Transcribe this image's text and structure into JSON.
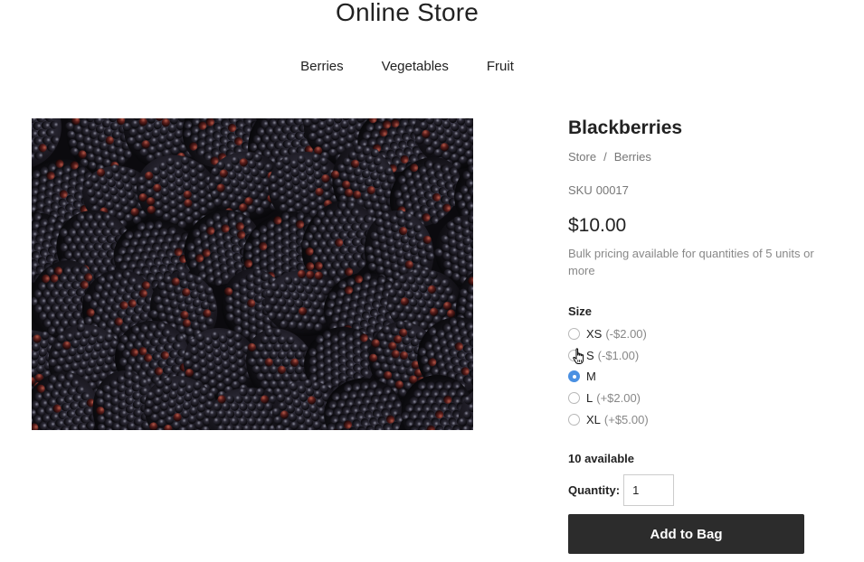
{
  "store": {
    "title": "Online Store"
  },
  "nav": {
    "items": [
      "Berries",
      "Vegetables",
      "Fruit"
    ]
  },
  "product": {
    "name": "Blackberries",
    "breadcrumb": [
      "Store",
      "Berries"
    ],
    "breadcrumb_separator": "/",
    "sku_label": "SKU",
    "sku": "00017",
    "price": "$10.00",
    "bulk_note": "Bulk pricing available for quantities of 5 units or more",
    "image_subject": "blackberries",
    "size": {
      "label": "Size",
      "selected": "M",
      "options": [
        {
          "name": "XS",
          "adjustment": "(-$2.00)"
        },
        {
          "name": "S",
          "adjustment": "(-$1.00)"
        },
        {
          "name": "M",
          "adjustment": ""
        },
        {
          "name": "L",
          "adjustment": "(+$2.00)"
        },
        {
          "name": "XL",
          "adjustment": "(+$5.00)"
        }
      ]
    },
    "availability": "10 available",
    "quantity": {
      "label": "Quantity:",
      "value": "1"
    },
    "add_button_label": "Add to Bag"
  },
  "colors": {
    "radio_selected": "#4a90e2",
    "button_bg": "#2c2c2c",
    "muted_text": "#888888"
  },
  "cursor": {
    "icon": "hand-pointer-icon"
  }
}
